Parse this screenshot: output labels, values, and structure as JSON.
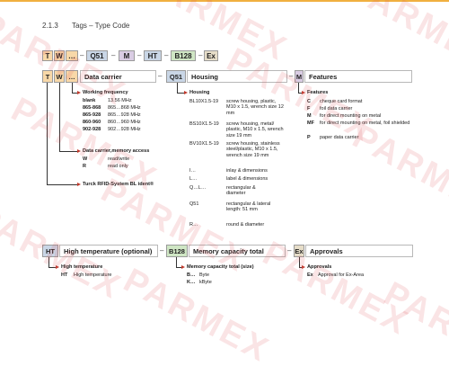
{
  "section": {
    "number": "2.1.3",
    "title": "Tags – Type Code"
  },
  "code_row": {
    "segments": [
      "T",
      "W",
      "…",
      "Q51",
      "M",
      "HT",
      "B128",
      "Ex"
    ],
    "dash": "–"
  },
  "bars": {
    "data_carrier": {
      "code": [
        "T",
        "W",
        "…"
      ],
      "label": "Data carrier"
    },
    "housing": {
      "code": "Q51",
      "label": "Housing"
    },
    "features": {
      "code": "M",
      "label": "Features"
    },
    "high_temp": {
      "code": "HT",
      "label": "High temperature (optional)"
    },
    "memory": {
      "code": "B128",
      "label": "Memory capacity total"
    },
    "approvals": {
      "code": "Ex",
      "label": "Approvals"
    },
    "dash": "–"
  },
  "working_frequency": {
    "title": "Working frequency",
    "rows": [
      {
        "k": "blank",
        "v": "13.56 MHz"
      },
      {
        "k": "865-868",
        "v": "865…868 MHz"
      },
      {
        "k": "865-928",
        "v": "865…928 MHz"
      },
      {
        "k": "860-960",
        "v": "860…960 MHz"
      },
      {
        "k": "902-928",
        "v": "902…928 MHz"
      }
    ]
  },
  "memory_access": {
    "title": "Data carrier,memory access",
    "rows": [
      {
        "k": "W",
        "v": "read/write"
      },
      {
        "k": "R",
        "v": "read only"
      }
    ]
  },
  "ident": {
    "title": "Turck RFID-System BL ident®"
  },
  "housing_list": {
    "title": "Housing",
    "rows": [
      {
        "k": "BL10X1.5-19",
        "v": "screw housing, plastic, M10 x 1.5, wrench size 12 mm"
      },
      {
        "k": "BS10X1.5-19",
        "v": "screw housing, metal/ plastic, M10 x 1.5, wrench size 19 mm"
      },
      {
        "k": "BV10X1.5-19",
        "v": "screw housing, stainless steel/plastic, M10 x 1.5, wrench size 19 mm"
      },
      {
        "k": "I…",
        "v": "inlay & dimensions"
      },
      {
        "k": "L…",
        "v": "label & dimensions"
      },
      {
        "k": "Q…L…",
        "v": "rectangular & diameter"
      },
      {
        "k": "Q51",
        "v": "rectangular & lateral length: 51 mm"
      },
      {
        "k": "R…",
        "v": "round & diameter"
      }
    ]
  },
  "features_list": {
    "title": "Features",
    "rows": [
      {
        "k": "C",
        "v": "cheque card format"
      },
      {
        "k": "F",
        "v": "foil data carrier"
      },
      {
        "k": "M",
        "v": "for direct mounting on metal"
      },
      {
        "k": "MF",
        "v": "for direct mounting on metal, foil shielded"
      },
      {
        "k": "P",
        "v": "paper data carrier"
      }
    ]
  },
  "high_temp_list": {
    "title": "High temperature",
    "rows": [
      {
        "k": "HT",
        "v": "High temperature"
      }
    ]
  },
  "memory_list": {
    "title": "Memory capacity total (size)",
    "rows": [
      {
        "k": "B…",
        "v": "Byte"
      },
      {
        "k": "K…",
        "v": "kByte"
      }
    ]
  },
  "approvals_list": {
    "title": "Approvals",
    "rows": [
      {
        "k": "Ex",
        "v": "Approval for Ex-Area"
      }
    ]
  },
  "watermark": "PARMEX",
  "colors": {
    "orange": "#f8d8a8",
    "blue": "#c9d6e6",
    "green": "#cfe6c4",
    "purple": "#d9cce3",
    "arrow": "#c0392b"
  }
}
